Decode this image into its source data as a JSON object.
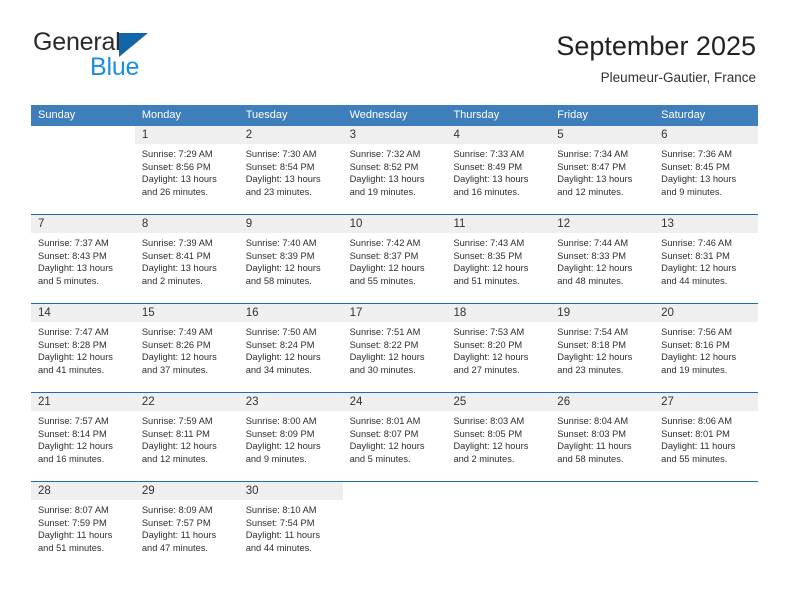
{
  "brand": {
    "name_part1": "General",
    "name_part2": "Blue",
    "triangle_color": "#1265a8",
    "blue_color": "#1a8fe0"
  },
  "header": {
    "title": "September 2025",
    "subtitle": "Pleumeur-Gautier, France"
  },
  "theme": {
    "header_row_bg": "#3d7ebb",
    "week_separator": "#1f6cb0",
    "daynum_band_bg": "#efefef",
    "text": "#2e2e2e"
  },
  "weekdays": [
    "Sunday",
    "Monday",
    "Tuesday",
    "Wednesday",
    "Thursday",
    "Friday",
    "Saturday"
  ],
  "labels": {
    "sunrise_prefix": "Sunrise:",
    "sunset_prefix": "Sunset:",
    "daylight_prefix": "Daylight:"
  },
  "weeks": [
    [
      {
        "day": "",
        "sunrise": "",
        "sunset": "",
        "daylight_line1": "",
        "daylight_line2": "",
        "blank": true
      },
      {
        "day": "1",
        "sunrise": "Sunrise: 7:29 AM",
        "sunset": "Sunset: 8:56 PM",
        "daylight_line1": "Daylight: 13 hours",
        "daylight_line2": "and 26 minutes."
      },
      {
        "day": "2",
        "sunrise": "Sunrise: 7:30 AM",
        "sunset": "Sunset: 8:54 PM",
        "daylight_line1": "Daylight: 13 hours",
        "daylight_line2": "and 23 minutes."
      },
      {
        "day": "3",
        "sunrise": "Sunrise: 7:32 AM",
        "sunset": "Sunset: 8:52 PM",
        "daylight_line1": "Daylight: 13 hours",
        "daylight_line2": "and 19 minutes."
      },
      {
        "day": "4",
        "sunrise": "Sunrise: 7:33 AM",
        "sunset": "Sunset: 8:49 PM",
        "daylight_line1": "Daylight: 13 hours",
        "daylight_line2": "and 16 minutes."
      },
      {
        "day": "5",
        "sunrise": "Sunrise: 7:34 AM",
        "sunset": "Sunset: 8:47 PM",
        "daylight_line1": "Daylight: 13 hours",
        "daylight_line2": "and 12 minutes."
      },
      {
        "day": "6",
        "sunrise": "Sunrise: 7:36 AM",
        "sunset": "Sunset: 8:45 PM",
        "daylight_line1": "Daylight: 13 hours",
        "daylight_line2": "and 9 minutes."
      }
    ],
    [
      {
        "day": "7",
        "sunrise": "Sunrise: 7:37 AM",
        "sunset": "Sunset: 8:43 PM",
        "daylight_line1": "Daylight: 13 hours",
        "daylight_line2": "and 5 minutes."
      },
      {
        "day": "8",
        "sunrise": "Sunrise: 7:39 AM",
        "sunset": "Sunset: 8:41 PM",
        "daylight_line1": "Daylight: 13 hours",
        "daylight_line2": "and 2 minutes."
      },
      {
        "day": "9",
        "sunrise": "Sunrise: 7:40 AM",
        "sunset": "Sunset: 8:39 PM",
        "daylight_line1": "Daylight: 12 hours",
        "daylight_line2": "and 58 minutes."
      },
      {
        "day": "10",
        "sunrise": "Sunrise: 7:42 AM",
        "sunset": "Sunset: 8:37 PM",
        "daylight_line1": "Daylight: 12 hours",
        "daylight_line2": "and 55 minutes."
      },
      {
        "day": "11",
        "sunrise": "Sunrise: 7:43 AM",
        "sunset": "Sunset: 8:35 PM",
        "daylight_line1": "Daylight: 12 hours",
        "daylight_line2": "and 51 minutes."
      },
      {
        "day": "12",
        "sunrise": "Sunrise: 7:44 AM",
        "sunset": "Sunset: 8:33 PM",
        "daylight_line1": "Daylight: 12 hours",
        "daylight_line2": "and 48 minutes."
      },
      {
        "day": "13",
        "sunrise": "Sunrise: 7:46 AM",
        "sunset": "Sunset: 8:31 PM",
        "daylight_line1": "Daylight: 12 hours",
        "daylight_line2": "and 44 minutes."
      }
    ],
    [
      {
        "day": "14",
        "sunrise": "Sunrise: 7:47 AM",
        "sunset": "Sunset: 8:28 PM",
        "daylight_line1": "Daylight: 12 hours",
        "daylight_line2": "and 41 minutes."
      },
      {
        "day": "15",
        "sunrise": "Sunrise: 7:49 AM",
        "sunset": "Sunset: 8:26 PM",
        "daylight_line1": "Daylight: 12 hours",
        "daylight_line2": "and 37 minutes."
      },
      {
        "day": "16",
        "sunrise": "Sunrise: 7:50 AM",
        "sunset": "Sunset: 8:24 PM",
        "daylight_line1": "Daylight: 12 hours",
        "daylight_line2": "and 34 minutes."
      },
      {
        "day": "17",
        "sunrise": "Sunrise: 7:51 AM",
        "sunset": "Sunset: 8:22 PM",
        "daylight_line1": "Daylight: 12 hours",
        "daylight_line2": "and 30 minutes."
      },
      {
        "day": "18",
        "sunrise": "Sunrise: 7:53 AM",
        "sunset": "Sunset: 8:20 PM",
        "daylight_line1": "Daylight: 12 hours",
        "daylight_line2": "and 27 minutes."
      },
      {
        "day": "19",
        "sunrise": "Sunrise: 7:54 AM",
        "sunset": "Sunset: 8:18 PM",
        "daylight_line1": "Daylight: 12 hours",
        "daylight_line2": "and 23 minutes."
      },
      {
        "day": "20",
        "sunrise": "Sunrise: 7:56 AM",
        "sunset": "Sunset: 8:16 PM",
        "daylight_line1": "Daylight: 12 hours",
        "daylight_line2": "and 19 minutes."
      }
    ],
    [
      {
        "day": "21",
        "sunrise": "Sunrise: 7:57 AM",
        "sunset": "Sunset: 8:14 PM",
        "daylight_line1": "Daylight: 12 hours",
        "daylight_line2": "and 16 minutes."
      },
      {
        "day": "22",
        "sunrise": "Sunrise: 7:59 AM",
        "sunset": "Sunset: 8:11 PM",
        "daylight_line1": "Daylight: 12 hours",
        "daylight_line2": "and 12 minutes."
      },
      {
        "day": "23",
        "sunrise": "Sunrise: 8:00 AM",
        "sunset": "Sunset: 8:09 PM",
        "daylight_line1": "Daylight: 12 hours",
        "daylight_line2": "and 9 minutes."
      },
      {
        "day": "24",
        "sunrise": "Sunrise: 8:01 AM",
        "sunset": "Sunset: 8:07 PM",
        "daylight_line1": "Daylight: 12 hours",
        "daylight_line2": "and 5 minutes."
      },
      {
        "day": "25",
        "sunrise": "Sunrise: 8:03 AM",
        "sunset": "Sunset: 8:05 PM",
        "daylight_line1": "Daylight: 12 hours",
        "daylight_line2": "and 2 minutes."
      },
      {
        "day": "26",
        "sunrise": "Sunrise: 8:04 AM",
        "sunset": "Sunset: 8:03 PM",
        "daylight_line1": "Daylight: 11 hours",
        "daylight_line2": "and 58 minutes."
      },
      {
        "day": "27",
        "sunrise": "Sunrise: 8:06 AM",
        "sunset": "Sunset: 8:01 PM",
        "daylight_line1": "Daylight: 11 hours",
        "daylight_line2": "and 55 minutes."
      }
    ],
    [
      {
        "day": "28",
        "sunrise": "Sunrise: 8:07 AM",
        "sunset": "Sunset: 7:59 PM",
        "daylight_line1": "Daylight: 11 hours",
        "daylight_line2": "and 51 minutes."
      },
      {
        "day": "29",
        "sunrise": "Sunrise: 8:09 AM",
        "sunset": "Sunset: 7:57 PM",
        "daylight_line1": "Daylight: 11 hours",
        "daylight_line2": "and 47 minutes."
      },
      {
        "day": "30",
        "sunrise": "Sunrise: 8:10 AM",
        "sunset": "Sunset: 7:54 PM",
        "daylight_line1": "Daylight: 11 hours",
        "daylight_line2": "and 44 minutes."
      },
      {
        "day": "",
        "sunrise": "",
        "sunset": "",
        "daylight_line1": "",
        "daylight_line2": "",
        "blank": true
      },
      {
        "day": "",
        "sunrise": "",
        "sunset": "",
        "daylight_line1": "",
        "daylight_line2": "",
        "blank": true
      },
      {
        "day": "",
        "sunrise": "",
        "sunset": "",
        "daylight_line1": "",
        "daylight_line2": "",
        "blank": true
      },
      {
        "day": "",
        "sunrise": "",
        "sunset": "",
        "daylight_line1": "",
        "daylight_line2": "",
        "blank": true
      }
    ]
  ]
}
